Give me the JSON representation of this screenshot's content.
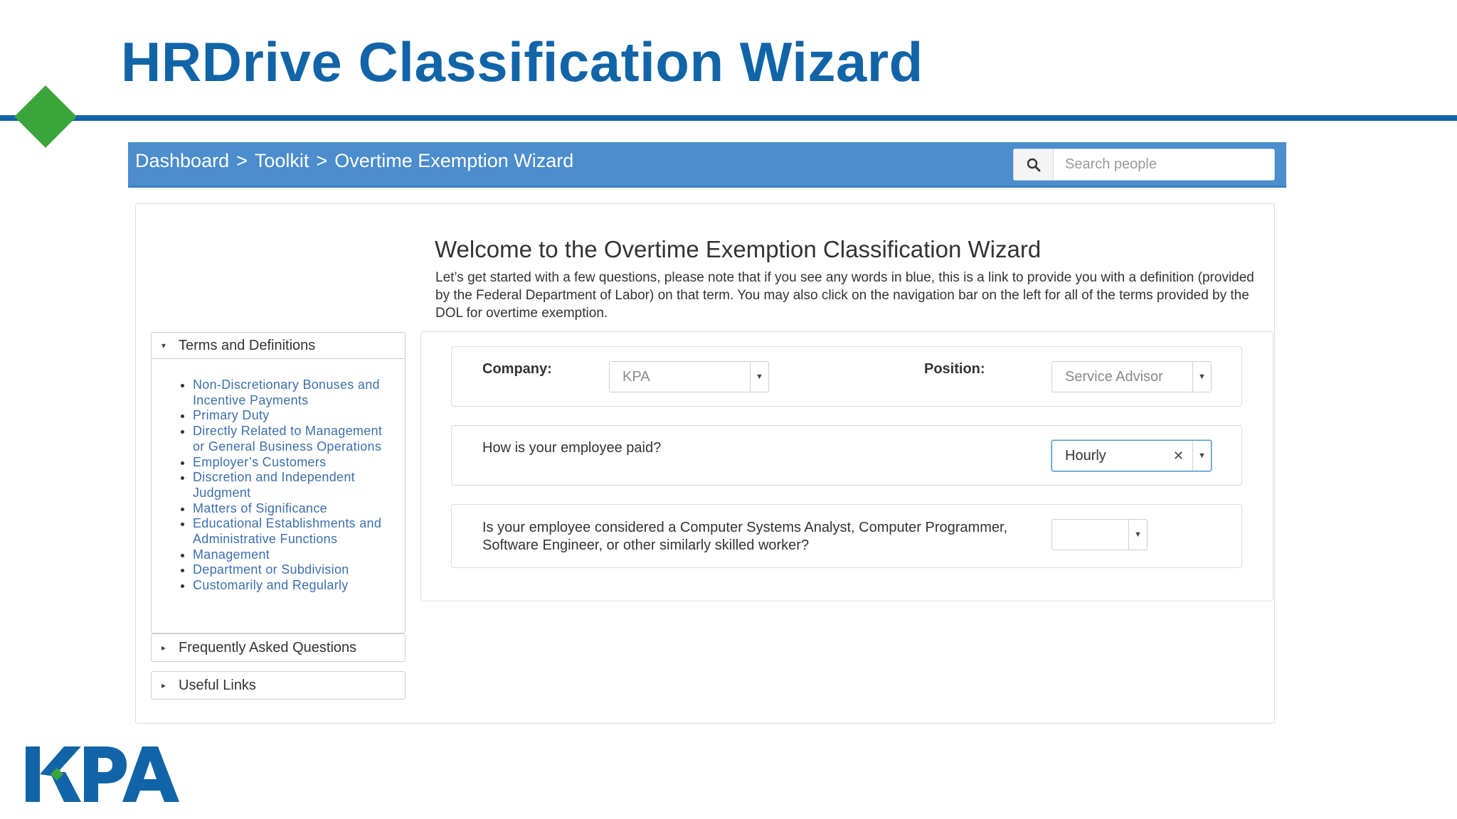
{
  "slide": {
    "title": "HRDrive Classification Wizard"
  },
  "navbar": {
    "crumb_dashboard": "Dashboard",
    "sep1": ">",
    "crumb_toolkit": "Toolkit",
    "sep2": ">",
    "crumb_current": "Overtime Exemption Wizard",
    "search_placeholder": "Search people"
  },
  "welcome": {
    "title": "Welcome to the Overtime Exemption Classification Wizard",
    "intro": "Let’s get started with a few questions, please note that if you see any words in blue, this is a link to provide you with a definition (provided by the Federal Department of Labor) on that term. You may also click on the navigation bar on the left for all of the terms provided by the DOL for overtime exemption."
  },
  "sidebar": {
    "terms_header": "Terms and Definitions",
    "terms": [
      "Non-Discretionary Bonuses and Incentive Payments",
      "Primary Duty",
      "Directly Related to Management or General Business Operations",
      "Employer’s Customers",
      "Discretion and Independent Judgment",
      "Matters of Significance",
      "Educational Establishments and Administrative Functions",
      "Management",
      "Department or Subdivision",
      "Customarily and Regularly"
    ],
    "faq_header": "Frequently Asked Questions",
    "links_header": "Useful Links"
  },
  "form": {
    "company_label": "Company:",
    "company_value": "KPA",
    "position_label": "Position:",
    "position_value": "Service Advisor",
    "paid_question": "How is your employee paid?",
    "paid_value": "Hourly",
    "computer_question": "Is your employee considered a Computer Systems Analyst, Computer Programmer, Software Engineer, or other similarly skilled worker?",
    "computer_value": ""
  },
  "icons": {
    "search": "search-icon",
    "dropdown": "chevron-down-icon",
    "clear": "close-icon",
    "expanded": "caret-down-icon",
    "collapsed": "caret-right-icon"
  },
  "colors": {
    "brand_blue": "#1164a8",
    "nav_blue": "#4b8dcd",
    "accent_green": "#3aa53a",
    "link_blue": "#3d6fae"
  },
  "logo": {
    "text": "KPA"
  }
}
